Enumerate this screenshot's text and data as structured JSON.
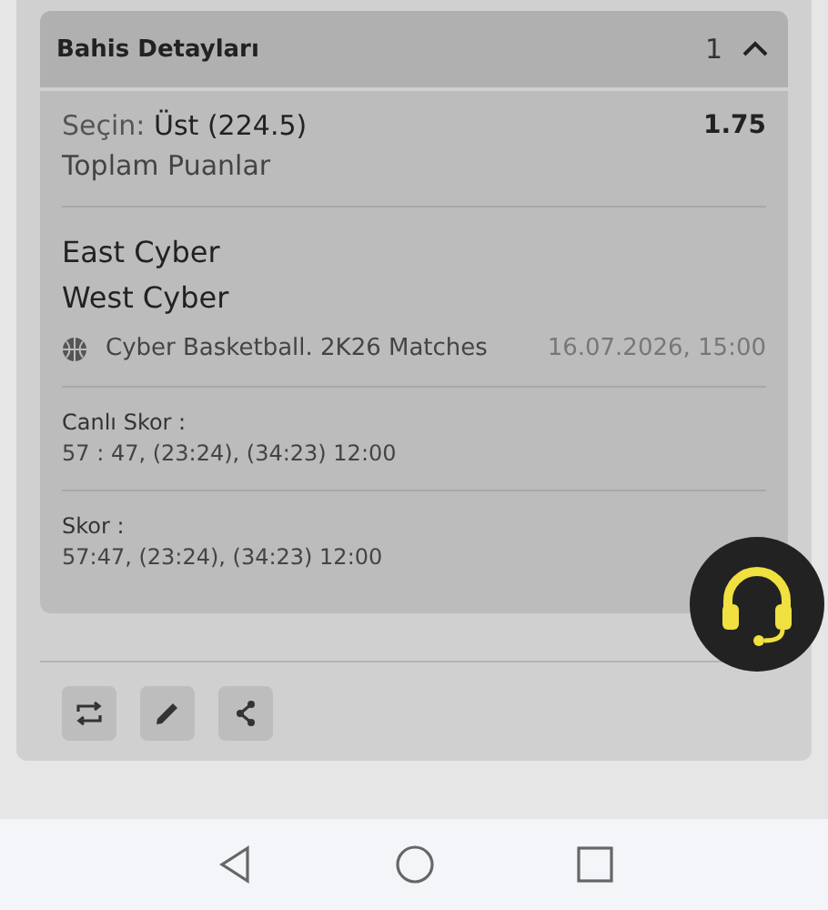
{
  "bet_details": {
    "title": "Bahis Detayları",
    "count": "1",
    "expanded": true
  },
  "selection": {
    "label": "Seçin:",
    "value": "Üst (224.5)",
    "odds": "1.75",
    "market": "Toplam Puanlar"
  },
  "teams": [
    "East Cyber",
    "West Cyber"
  ],
  "event": {
    "league": "Cyber Basketball. 2K26 Matches",
    "datetime": "16.07.2026, 15:00"
  },
  "scores": [
    {
      "label": "Canlı Skor :",
      "value": "57 : 47, (23:24), (34:23) 12:00"
    },
    {
      "label": "Skor :",
      "value": "57:47, (23:24), (34:23) 12:00"
    }
  ],
  "actions": [
    {
      "kind": "repeat"
    },
    {
      "kind": "edit"
    },
    {
      "kind": "share"
    }
  ]
}
